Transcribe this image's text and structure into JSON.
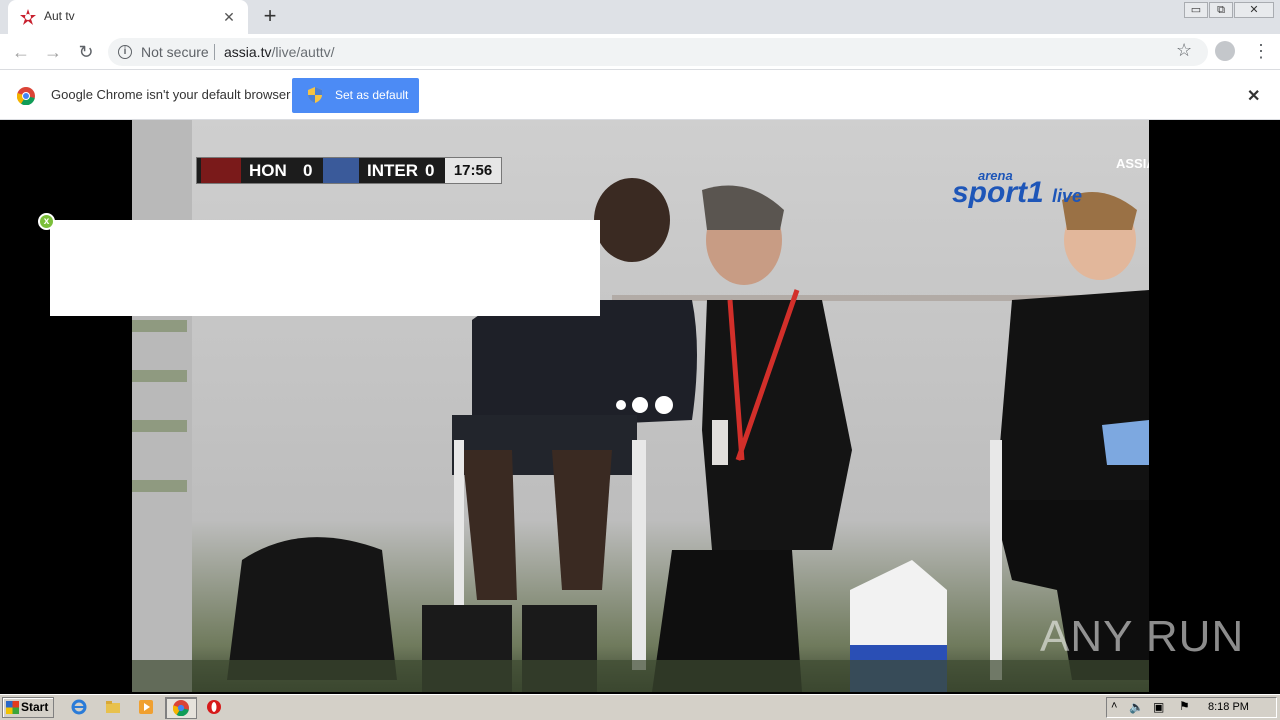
{
  "tab": {
    "title": "Aut tv",
    "close": "✕",
    "new_tab": "+"
  },
  "window_controls": {
    "minimize": "▭",
    "restore": "⧉",
    "close": "✕"
  },
  "toolbar": {
    "back": "←",
    "forward": "→",
    "reload": "↻",
    "security_label": "Not secure",
    "url_host": "assia.tv",
    "url_path": "/live/auttv/",
    "bookmark_icon": "☆",
    "menu_icon": "⋮"
  },
  "infobar": {
    "message": "Google Chrome isn't your default browser",
    "button_label": "Set as default",
    "close": "✕"
  },
  "video": {
    "scoreboard": {
      "home": "HON",
      "home_score": "0",
      "away": "INTER",
      "away_score": "0",
      "clock": "17:56"
    },
    "channel_logo": "sport1",
    "channel_prefix": "arena",
    "channel_suffix": "live",
    "site_logo": "ASSIA.TV",
    "watermark": "ANY RUN"
  },
  "ad": {
    "close": "x"
  },
  "taskbar": {
    "start_label": "Start",
    "clock": "8:18 PM"
  },
  "colors": {
    "accent": "#4c8bf5",
    "ad_close": "#7bbf3a",
    "scoreboard_bg": "#1c1c1c"
  }
}
